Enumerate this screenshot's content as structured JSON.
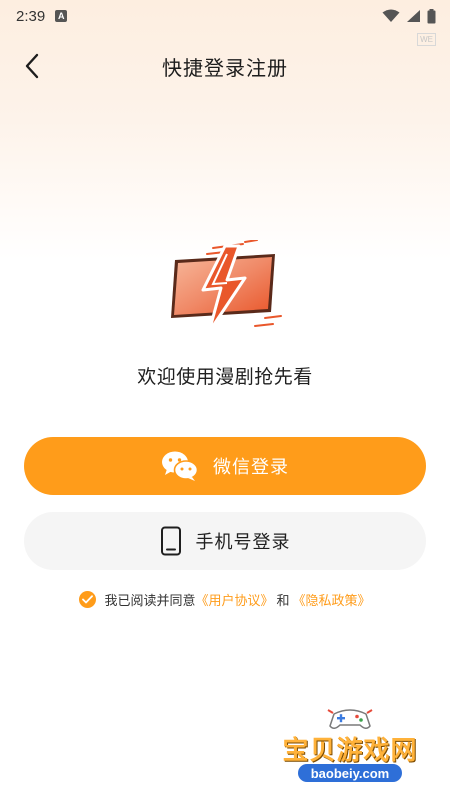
{
  "status_bar": {
    "time": "2:39",
    "notification_glyph": "A",
    "badge": "WE"
  },
  "nav": {
    "title": "快捷登录注册"
  },
  "welcome": {
    "text": "欢迎使用漫剧抢先看"
  },
  "buttons": {
    "wechat_label": "微信登录",
    "phone_label": "手机号登录"
  },
  "agreement": {
    "checked": true,
    "prefix": "我已阅读并同意",
    "user_agreement": "《用户协议》",
    "and": "和",
    "privacy_policy": "《隐私政策》"
  },
  "watermark": {
    "title": "宝贝游戏网",
    "url": "baobeiy.com"
  },
  "colors": {
    "accent": "#ff9c1a",
    "secondary_button": "#f5f5f5",
    "logo_red": "#e9572b"
  }
}
